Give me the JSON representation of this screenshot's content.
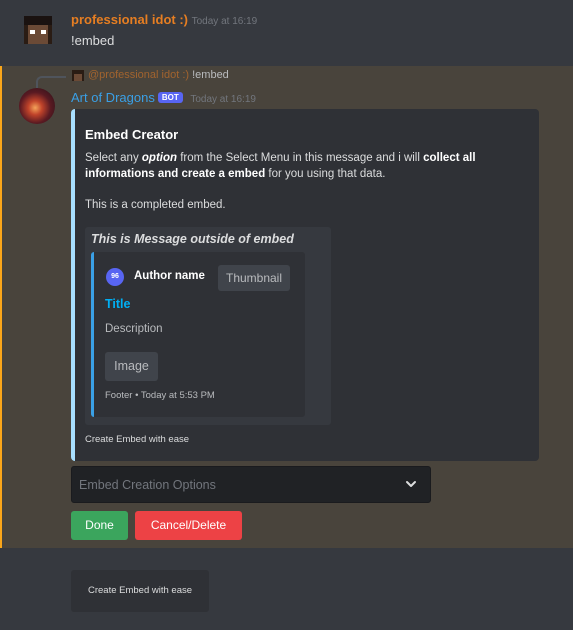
{
  "message1": {
    "author": "professional idot :)",
    "timestamp": "Today at 16:19",
    "content": "!embed"
  },
  "message2": {
    "reply_name": "@professional idot :)",
    "reply_content": "!embed",
    "author": "Art of Dragons",
    "badge": "BOT",
    "timestamp": "Today at 16:19",
    "embed": {
      "title": "Embed Creator",
      "desc_1": "Select any ",
      "desc_option": "option",
      "desc_2": " from the Select Menu in this message and i will ",
      "desc_bold": "collect all informations and create a embed",
      "desc_3": " for you using that data.",
      "completed": "This is a completed embed.",
      "footer": "Create Embed with ease",
      "accent_color": "#a8dfff",
      "sample": {
        "outside_text": "This is Message outside of embed",
        "author_name": "Author name",
        "thumbnail": "Thumbnail",
        "title": "Title",
        "description": "Description",
        "image": "Image",
        "footer": "Footer • Today at 5:53 PM",
        "accent_color": "#3aa0e6"
      }
    },
    "select": {
      "placeholder": "Embed Creation Options"
    },
    "buttons": {
      "done": "Done",
      "cancel": "Cancel/Delete"
    }
  },
  "bottom": {
    "label": "Create Embed with ease"
  }
}
